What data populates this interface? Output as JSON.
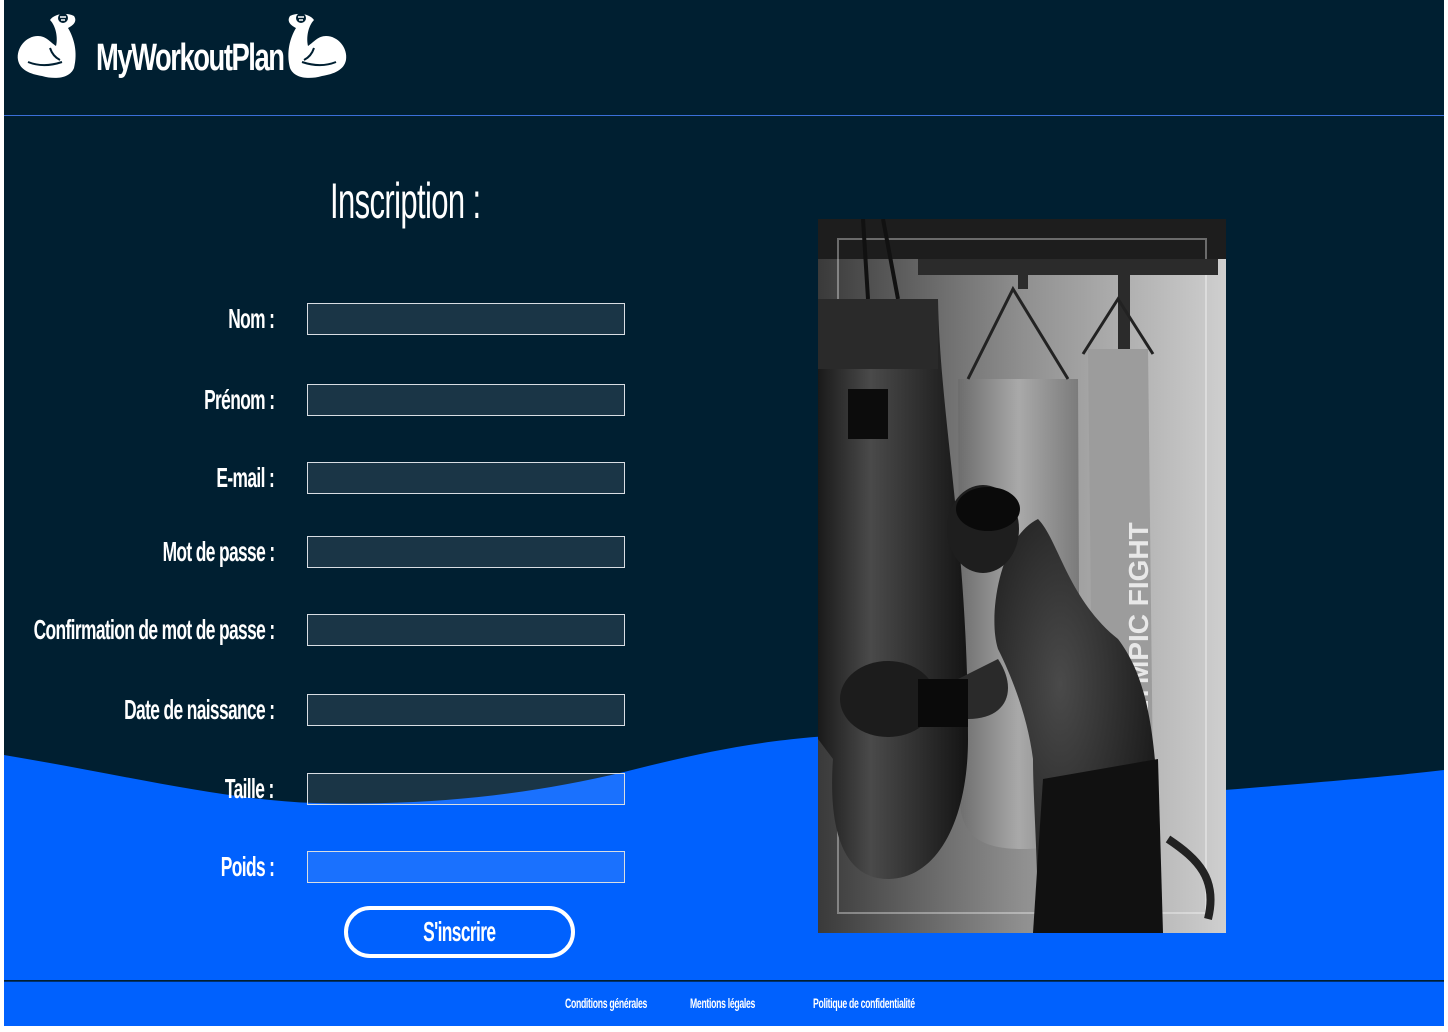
{
  "header": {
    "logo_text": "MyWorkoutPlan"
  },
  "form": {
    "title": "Inscription :",
    "fields": [
      {
        "label": "Nom :",
        "value": ""
      },
      {
        "label": "Prénom :",
        "value": ""
      },
      {
        "label": "E-mail :",
        "value": ""
      },
      {
        "label": "Mot de passe :",
        "value": ""
      },
      {
        "label": "Confirmation de mot de passe :",
        "value": ""
      },
      {
        "label": "Date de naissance :",
        "value": ""
      },
      {
        "label": "Taille :",
        "value": ""
      },
      {
        "label": "Poids :",
        "value": ""
      }
    ],
    "submit_label": "S'inscrire"
  },
  "photo": {
    "subject": "boxer leaning on punching bag",
    "style": "black-and-white"
  },
  "footer": {
    "links": [
      "Conditions générales",
      "Mentions légales",
      "Politique de confidentialité"
    ]
  },
  "colors": {
    "background": "#001f31",
    "accent": "#0061fe",
    "input_border": "#d8dde3",
    "text": "#ffffff"
  },
  "icons": [
    "flexed-biceps-icon"
  ]
}
